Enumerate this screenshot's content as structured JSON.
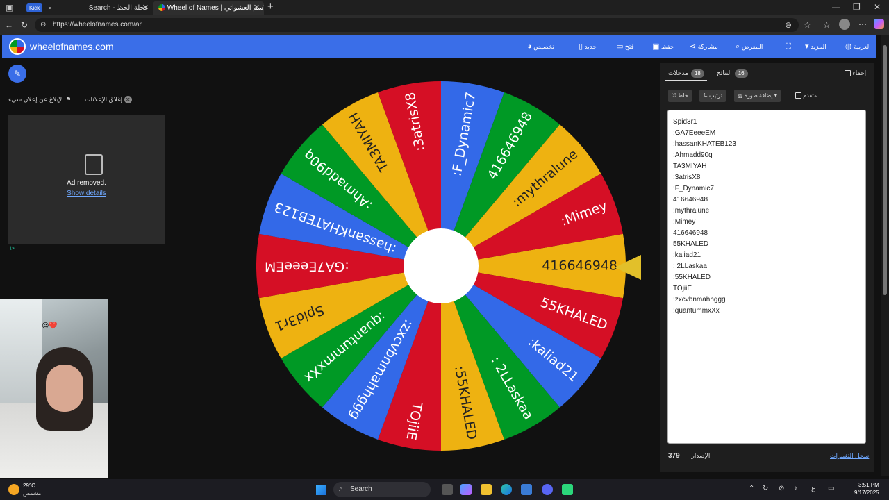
{
  "browser": {
    "tabs": [
      {
        "badge": "Kick",
        "label": "Search - عجلة الحظ"
      },
      {
        "label": "Wheel of Names | الاسم العشوائي"
      }
    ],
    "new_tab_icon": "plus-icon",
    "url": "https://wheelofnames.com/ar"
  },
  "header": {
    "brand": "wheelofnames.com",
    "nav": {
      "customize": "تخصيص",
      "new": "جديد",
      "open": "فتح",
      "save": "حفظ",
      "share": "مشاركة",
      "gallery": "المعرض",
      "more": "المزيد",
      "language": "العربية"
    }
  },
  "left": {
    "close_ads": "إغلاق الإعلانات",
    "report_ad": "الإبلاغ عن إعلان سيء",
    "ad_removed": "Ad removed.",
    "show_details": "Show details"
  },
  "wheel": {
    "colors": [
      "#eeb211",
      "#d50f25",
      "#3369e8",
      "#009925"
    ],
    "segments": [
      "416646948",
      "55KHALED",
      ":kaliad21",
      ": 2LLaskaa",
      ":55KHALED",
      "TOjiiE",
      ":zxcvbnmahhggg",
      ":quantummxXx",
      "Spid3r1",
      ":GA7EeeeEM",
      ":hassanKHATEB123",
      ":Ahmadd90q",
      "TA3MIYAH",
      ":3atrisX8",
      ":F_Dynamic7",
      "416646948",
      ":mythralune",
      ":Mimey"
    ]
  },
  "panel": {
    "entries_tab": "مدخلات",
    "entries_count": "18",
    "results_tab": "النتائج",
    "results_count": "16",
    "hide": "إخفاء",
    "shuffle": "خلط",
    "sort": "ترتيب",
    "add_image": "إضافة صورة",
    "advanced": "متقدم",
    "entries": [
      "Spid3r1",
      ":GA7EeeeEM",
      ":hassanKHATEB123",
      ":Ahmadd90q",
      "TA3MIYAH",
      ":3atrisX8",
      ":F_Dynamic7",
      "416646948",
      ":mythralune",
      ":Mimey",
      "416646948",
      "55KHALED",
      ":kaliad21",
      ": 2LLaskaa",
      ":55KHALED",
      "TOjiiE",
      ":zxcvbnmahhggg",
      ":quantummxXx"
    ],
    "version_label": "الإصدار",
    "version": "379",
    "changelog": "سجل التغييرات"
  },
  "taskbar": {
    "temperature": "29°C",
    "weather": "مشمس",
    "search": "Search",
    "lang": "ع",
    "time": "3:51 PM",
    "date": "9/17/2025"
  }
}
